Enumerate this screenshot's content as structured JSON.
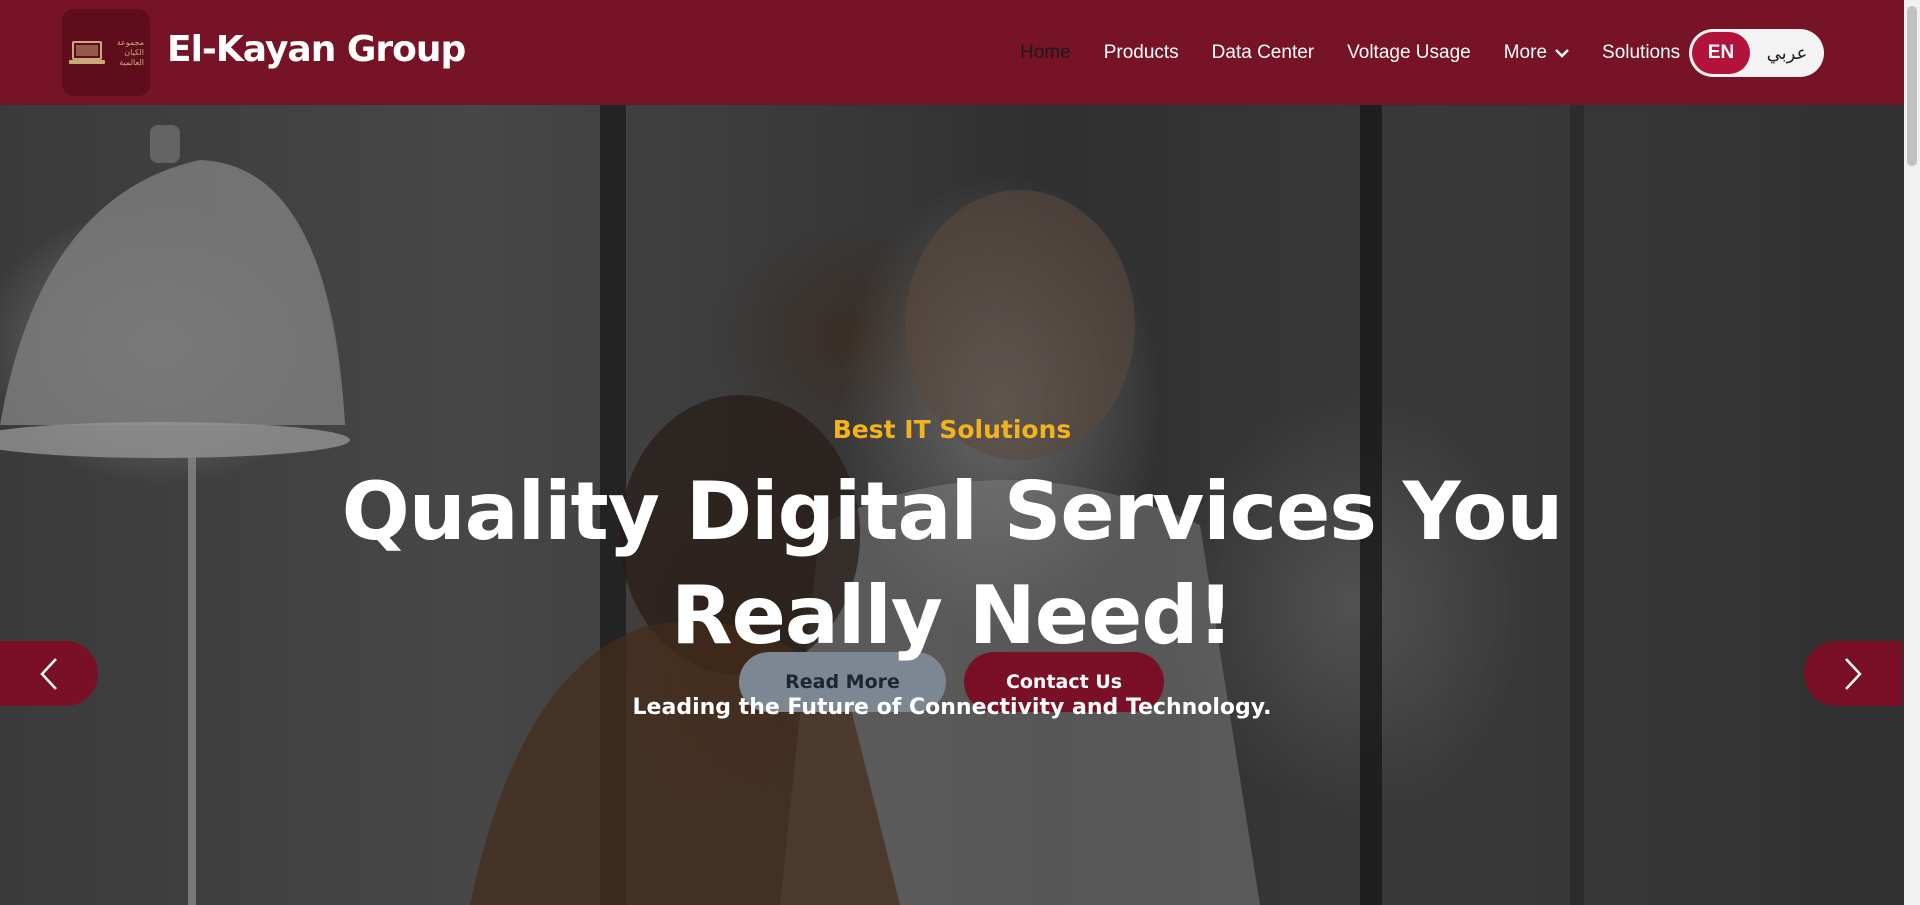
{
  "header": {
    "brand": "El-Kayan Group",
    "logo_text": "مجموعة الكيان العالمية",
    "nav": [
      {
        "label": "Home",
        "active": true
      },
      {
        "label": "Products",
        "active": false
      },
      {
        "label": "Data Center",
        "active": false
      },
      {
        "label": "Voltage Usage",
        "active": false
      },
      {
        "label": "More",
        "active": false,
        "icon": "chevron-down-icon"
      },
      {
        "label": "Solutions",
        "active": false
      }
    ],
    "lang": {
      "en": "EN",
      "ar": "عربي"
    }
  },
  "hero": {
    "subtitle": "Best IT Solutions",
    "headline": "Quality Digital Services You Really Need!",
    "tagline": "Leading the Future of Connectivity and Technology.",
    "read_more": "Read More",
    "contact_us": "Contact Us",
    "prev_icon": "chevron-left-icon",
    "next_icon": "chevron-right-icon"
  },
  "colors": {
    "header_bg": "#771326",
    "accent": "#f2b31c",
    "button_primary": "#7a1027",
    "button_secondary": "#7d8693",
    "lang_active": "#b3123a"
  }
}
